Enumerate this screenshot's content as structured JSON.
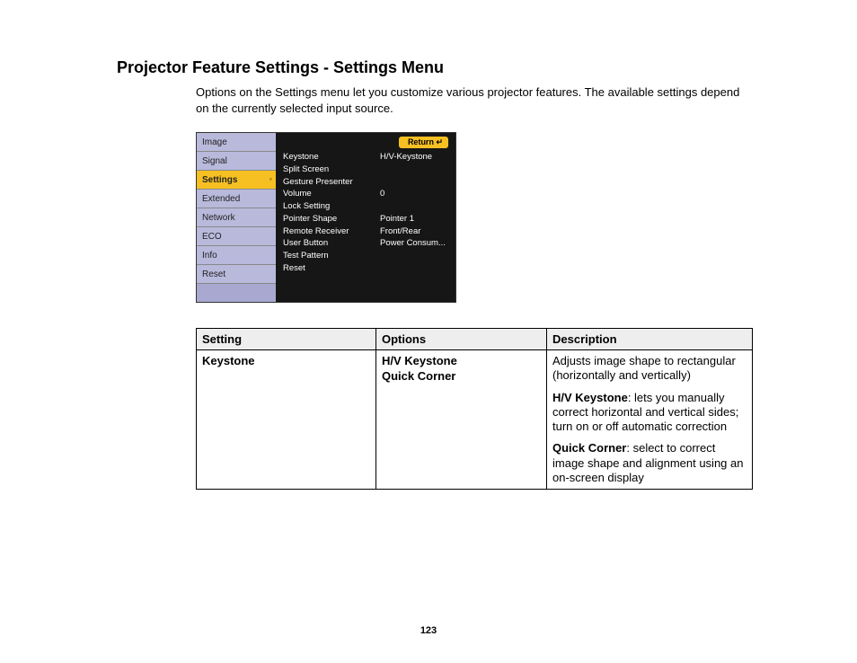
{
  "title": "Projector Feature Settings - Settings Menu",
  "intro": "Options on the Settings menu let you customize various projector features. The available settings depend on the currently selected input source.",
  "osd": {
    "return_label": "Return",
    "left_tabs": [
      "Image",
      "Signal",
      "Settings",
      "Extended",
      "Network",
      "ECO",
      "Info",
      "Reset"
    ],
    "selected_index": 2,
    "rows": [
      {
        "k": "Keystone",
        "v": "H/V-Keystone"
      },
      {
        "k": "Split Screen",
        "v": ""
      },
      {
        "k": "Gesture Presenter",
        "v": ""
      },
      {
        "k": "Volume",
        "v": "0"
      },
      {
        "k": "Lock Setting",
        "v": ""
      },
      {
        "k": "Pointer Shape",
        "v": "Pointer 1"
      },
      {
        "k": "Remote Receiver",
        "v": "Front/Rear"
      },
      {
        "k": "User Button",
        "v": "Power Consum..."
      },
      {
        "k": "Test Pattern",
        "v": ""
      },
      {
        "k": "Reset",
        "v": ""
      }
    ]
  },
  "table": {
    "headers": {
      "setting": "Setting",
      "options": "Options",
      "description": "Description"
    },
    "row": {
      "setting": "Keystone",
      "options": [
        "H/V Keystone",
        "Quick Corner"
      ],
      "descriptions": [
        {
          "lead": "",
          "text": "Adjusts image shape to rectangular (horizontally and vertically)"
        },
        {
          "lead": "H/V Keystone",
          "text": ": lets you manually correct horizontal and vertical sides; turn on or off automatic correction"
        },
        {
          "lead": "Quick Corner",
          "text": ": select to correct image shape and alignment using an on-screen display"
        }
      ]
    }
  },
  "page_number": "123"
}
